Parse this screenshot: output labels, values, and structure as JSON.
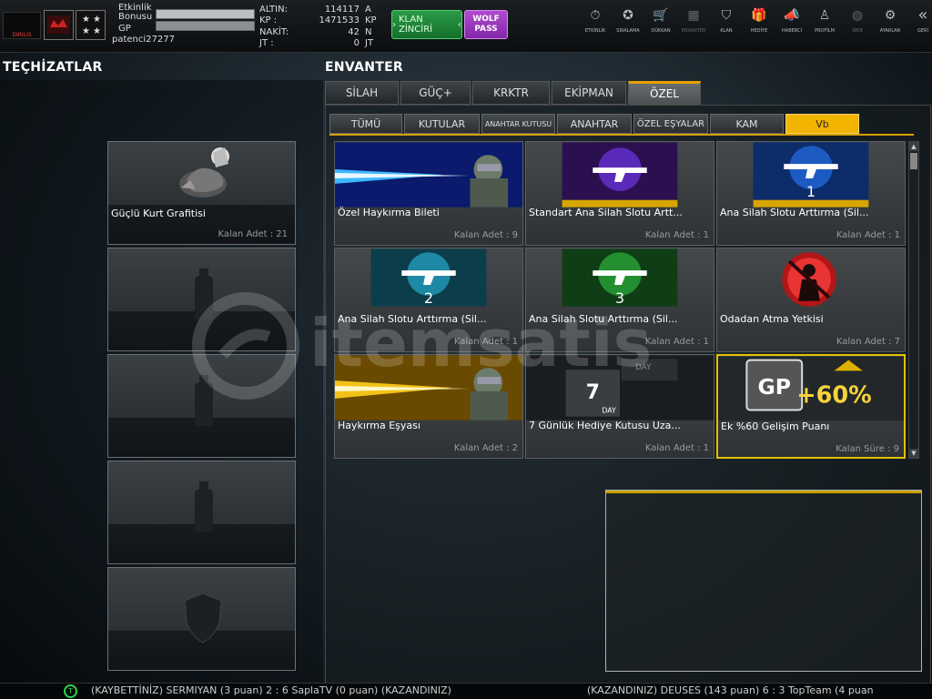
{
  "player": {
    "logo_text": "DIRILIS",
    "etkinlik_label": "Etkinlik",
    "bonus_label": "Bonusu",
    "gp_label": "GP",
    "username": "patenci27277"
  },
  "currency": [
    {
      "label": "ALTIN:",
      "value": "114117",
      "unit": "A"
    },
    {
      "label": "KP :",
      "value": "1471533",
      "unit": "KP"
    },
    {
      "label": "NAKİT:",
      "value": "42",
      "unit": "N"
    },
    {
      "label": "JT :",
      "value": "0",
      "unit": "JT"
    }
  ],
  "buttons": {
    "klan_zinciri": "KLAN ZİNCİRİ",
    "wolf_pass_1": "WOLF",
    "wolf_pass_2": "PASS"
  },
  "nav": [
    {
      "label": "ETKİNLİK",
      "icon": "stopwatch-icon",
      "glyph": "⏱"
    },
    {
      "label": "SIRALAMA",
      "icon": "medal-icon",
      "glyph": "✪"
    },
    {
      "label": "DÜKKAN",
      "icon": "cart-icon",
      "glyph": "🛒"
    },
    {
      "label": "ENVANTER",
      "icon": "inventory-icon",
      "glyph": "▦"
    },
    {
      "label": "KLAN",
      "icon": "shield-icon",
      "glyph": "⛉"
    },
    {
      "label": "HEDİYE",
      "icon": "gift-icon",
      "glyph": "🎁"
    },
    {
      "label": "HABERCİ",
      "icon": "megaphone-icon",
      "glyph": "📣"
    },
    {
      "label": "PROFİLM",
      "icon": "profile-icon",
      "glyph": "♙"
    },
    {
      "label": "WEB",
      "icon": "globe-icon",
      "glyph": "◍"
    },
    {
      "label": "AYARLAR",
      "icon": "gear-icon",
      "glyph": "⚙"
    },
    {
      "label": "GERİ",
      "icon": "back-icon",
      "glyph": "«"
    }
  ],
  "sections": {
    "equipment_title": "TEÇHİZATLAR",
    "inventory_title": "ENVANTER"
  },
  "equipment_slots": [
    {
      "name": "Güçlü Kurt Grafitisi",
      "count": "Kalan Adet : 21"
    },
    {
      "name": "",
      "count": ""
    },
    {
      "name": "",
      "count": ""
    },
    {
      "name": "",
      "count": ""
    },
    {
      "name": "",
      "count": ""
    }
  ],
  "tabs": [
    "SİLAH",
    "GÜÇ+",
    "KRKTR",
    "EKİPMAN",
    "ÖZEL"
  ],
  "subtabs": [
    "TÜMÜ",
    "KUTULAR",
    "ANAHTAR KUTUSU",
    "ANAHTAR",
    "ÖZEL EŞYALAR",
    "KAM",
    "Vb"
  ],
  "items": [
    {
      "name": "Özel Haykırma Bileti",
      "count": "Kalan Adet : 9"
    },
    {
      "name": "Standart Ana Silah Slotu Artt...",
      "count": "Kalan Adet : 1"
    },
    {
      "name": "Ana Silah Slotu Arttırma (Sil...",
      "count": "Kalan Adet : 1",
      "badge": "1"
    },
    {
      "name": "Ana Silah Slotu Arttırma (Sil...",
      "count": "Kalan Adet : 1",
      "badge": "2"
    },
    {
      "name": "Ana Silah Slotu Arttırma (Sil...",
      "count": "Kalan Adet : 1",
      "badge": "3"
    },
    {
      "name": "Odadan Atma Yetkisi",
      "count": "Kalan Adet : 7"
    },
    {
      "name": "Haykırma Eşyası",
      "count": "Kalan Adet : 2"
    },
    {
      "name": "7 Günlük Hediye Kutusu Uza...",
      "count": "Kalan Adet : 1",
      "badge": "7",
      "badge_sub": "DAY"
    },
    {
      "name": "Ek %60 Gelişim Puanı",
      "count": "Kalan Süre : 9",
      "badge": "+60%",
      "badge_sub": "GP"
    }
  ],
  "ticker": {
    "left": "(KAYBETTİNİZ) SERMIYAN (3 puan) 2 : 6 SaplaTV (0 puan) (KAZANDINIZ)",
    "right": "(KAZANDINIZ) DEUSES (143 puan) 6 : 3 TopTeam (4 puan"
  },
  "watermark": "itemsatis",
  "colors": {
    "accent": "#f3b400",
    "klan_button": "#1f8a3a",
    "wolf_button": "#9a36c0",
    "selected_border": "#e2c200"
  }
}
